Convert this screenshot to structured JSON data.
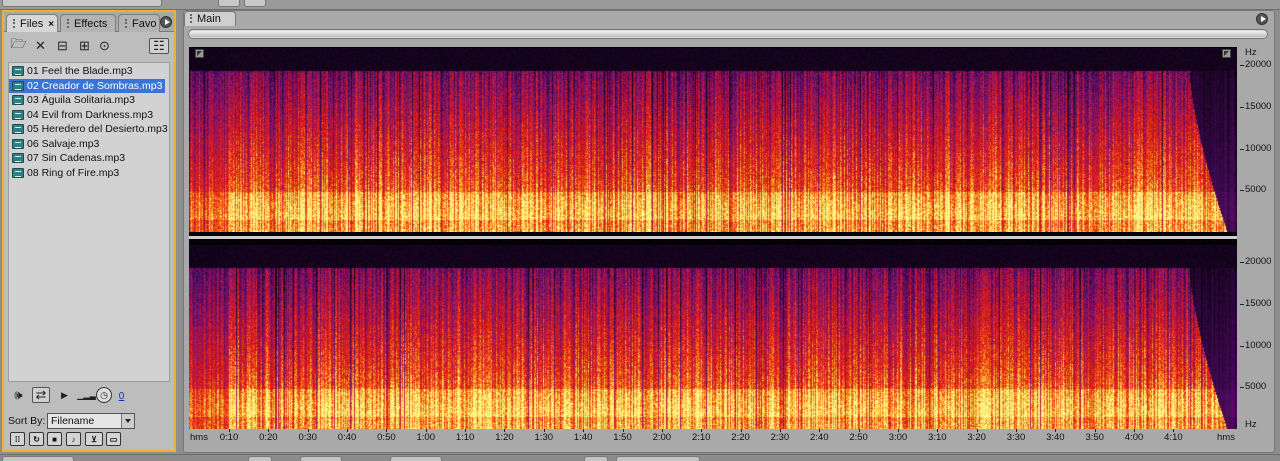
{
  "files_panel": {
    "tabs": [
      {
        "label": "Files",
        "active": true,
        "closable": true
      },
      {
        "label": "Effects",
        "active": false
      },
      {
        "label": "Favo",
        "active": false
      }
    ],
    "toolbar_icons": [
      "open-file-icon",
      "close-file-icon",
      "import-icon",
      "insert-into-multitrack-icon",
      "edit-file-icon",
      "show-options-icon"
    ],
    "files": [
      "01 Feel the Blade.mp3",
      "02 Creador de Sombras.mp3",
      "03 Águila Solitaria.mp3",
      "04 Evil from Darkness.mp3",
      "05 Heredero del Desierto.mp3",
      "06 Salvaje.mp3",
      "07 Sin Cadenas.mp3",
      "08 Ring of Fire.mp3"
    ],
    "selected_index": 1,
    "transport": {
      "volume_value": "0"
    },
    "sort_label": "Sort By:",
    "sort_value": "Filename"
  },
  "main_panel": {
    "tab_label": "Main",
    "freq_unit": "Hz",
    "freq_labels": [
      "20000",
      "15000",
      "10000",
      "5000"
    ],
    "time_labels": [
      "hms",
      "0:10",
      "0:20",
      "0:30",
      "0:40",
      "0:50",
      "1:00",
      "1:10",
      "1:20",
      "1:30",
      "1:40",
      "1:50",
      "2:00",
      "2:10",
      "2:20",
      "2:30",
      "2:40",
      "2:50",
      "3:00",
      "3:10",
      "3:20",
      "3:30",
      "3:40",
      "3:50",
      "4:00",
      "4:10",
      "hms"
    ],
    "view": "spectral frequency display",
    "channels": 2,
    "colors": {
      "high_energy": "#fff27a",
      "mid_energy": "#e8281a",
      "low_energy": "#5a1a7a",
      "silence": "#050208"
    }
  }
}
